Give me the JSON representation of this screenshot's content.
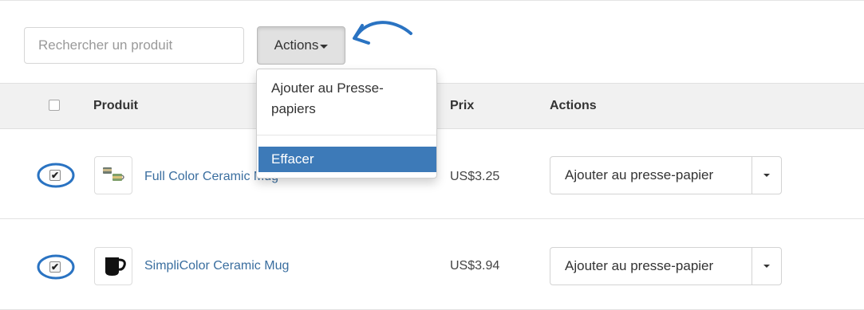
{
  "search": {
    "placeholder": "Rechercher un produit",
    "value": ""
  },
  "toolbar": {
    "actions_label": "Actions"
  },
  "table": {
    "headers": {
      "product": "Produit",
      "price": "Prix",
      "actions": "Actions"
    },
    "rows": [
      {
        "product": "Full Color Ceramic Mug",
        "price": "US$3.25",
        "action_label": "Ajouter au presse-papier",
        "checked": true
      },
      {
        "product": "SimpliColor Ceramic Mug",
        "price": "US$3.94",
        "action_label": "Ajouter au presse-papier",
        "checked": true
      }
    ]
  },
  "dropdown": {
    "items": [
      {
        "label": "Ajouter au Presse-papiers"
      },
      {
        "label": "Effacer",
        "active": true
      }
    ]
  },
  "colors": {
    "link": "#3a6e9f",
    "highlight": "#3d7ab8",
    "annotation": "#2a73c2"
  },
  "icons": [
    "arrow-annotation-icon",
    "caret-down-icon",
    "checkbox-icon",
    "mug-thumbnail-icon"
  ]
}
